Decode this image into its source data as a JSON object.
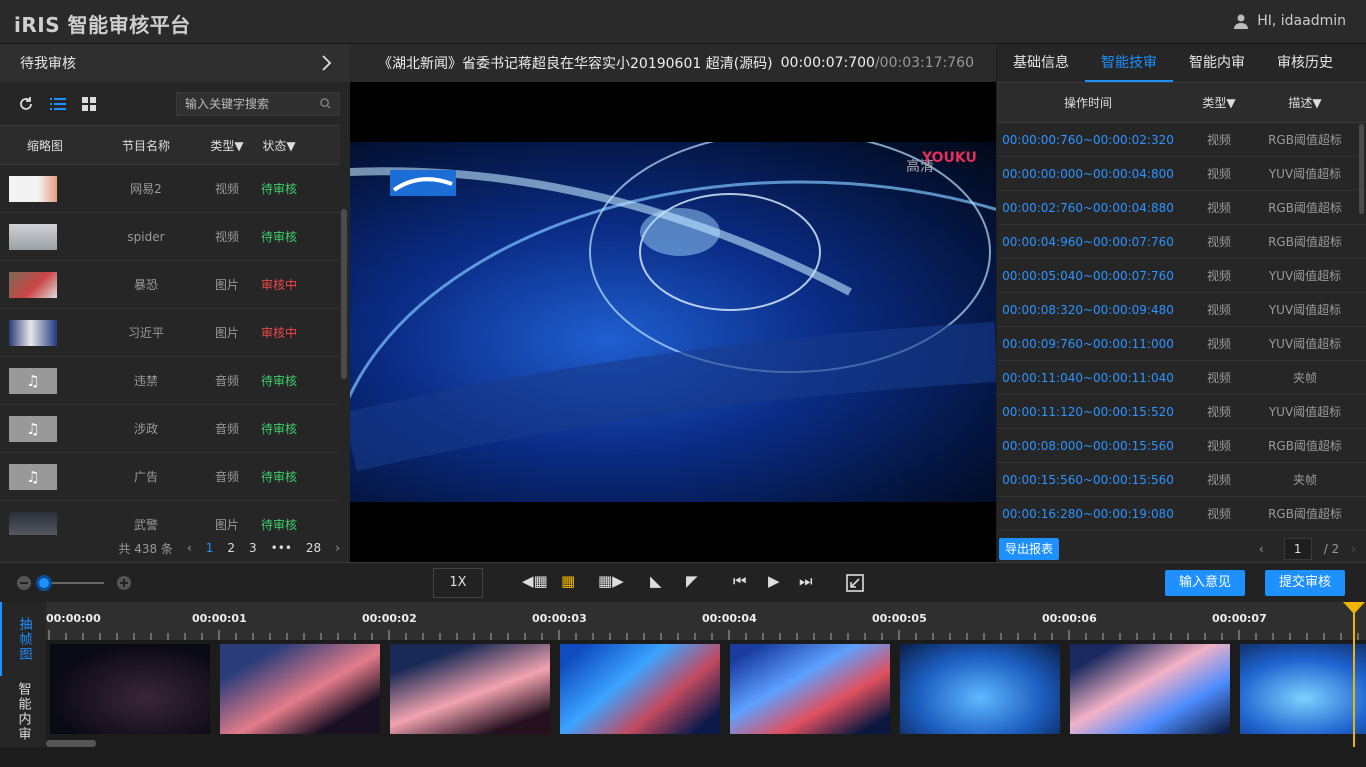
{
  "app": {
    "logo": "iRIS  智能审核平台",
    "user": "HI, idaadmin"
  },
  "left": {
    "title": "待我审核",
    "search_placeholder": "输入关键字搜索",
    "columns": [
      "缩略图",
      "节目名称",
      "类型",
      "状态"
    ],
    "rows": [
      {
        "name": "网易2",
        "type": "视频",
        "status": "待审核",
        "state": "ok"
      },
      {
        "name": "spider",
        "type": "视频",
        "status": "待审核",
        "state": "ok"
      },
      {
        "name": "暴恐",
        "type": "图片",
        "status": "审核中",
        "state": "ing"
      },
      {
        "name": "习近平",
        "type": "图片",
        "status": "审核中",
        "state": "ing"
      },
      {
        "name": "违禁",
        "type": "音频",
        "status": "待审核",
        "state": "ok"
      },
      {
        "name": "涉政",
        "type": "音频",
        "status": "待审核",
        "state": "ok"
      },
      {
        "name": "广告",
        "type": "音频",
        "status": "待审核",
        "state": "ok"
      },
      {
        "name": "武警",
        "type": "图片",
        "status": "待审核",
        "state": "ok"
      }
    ],
    "pager": {
      "total": "共 438 条",
      "pages": [
        "1",
        "2",
        "3",
        "•••",
        "28"
      ]
    }
  },
  "center": {
    "title": "《湖北新闻》省委书记蒋超良在华容实小20190601 超清(源码)",
    "current_time": "00:00:07:700",
    "duration": "/00:03:17:760",
    "watermark": "高清",
    "brand": "YOUKU"
  },
  "right": {
    "tabs": [
      "基础信息",
      "智能技审",
      "智能内审",
      "审核历史"
    ],
    "columns": [
      "操作时间",
      "类型",
      "描述"
    ],
    "rows": [
      {
        "time": "00:00:00:760~00:00:02:320",
        "type": "视频",
        "desc": "RGB阈值超标"
      },
      {
        "time": "00:00:00:000~00:00:04:800",
        "type": "视频",
        "desc": "YUV阈值超标"
      },
      {
        "time": "00:00:02:760~00:00:04:880",
        "type": "视频",
        "desc": "RGB阈值超标"
      },
      {
        "time": "00:00:04:960~00:00:07:760",
        "type": "视频",
        "desc": "RGB阈值超标"
      },
      {
        "time": "00:00:05:040~00:00:07:760",
        "type": "视频",
        "desc": "YUV阈值超标"
      },
      {
        "time": "00:00:08:320~00:00:09:480",
        "type": "视频",
        "desc": "YUV阈值超标"
      },
      {
        "time": "00:00:09:760~00:00:11:000",
        "type": "视频",
        "desc": "YUV阈值超标"
      },
      {
        "time": "00:00:11:040~00:00:11:040",
        "type": "视频",
        "desc": "夹帧"
      },
      {
        "time": "00:00:11:120~00:00:15:520",
        "type": "视频",
        "desc": "YUV阈值超标"
      },
      {
        "time": "00:00:08:000~00:00:15:560",
        "type": "视频",
        "desc": "RGB阈值超标"
      },
      {
        "time": "00:00:15:560~00:00:15:560",
        "type": "视频",
        "desc": "夹帧"
      },
      {
        "time": "00:00:16:280~00:00:19:080",
        "type": "视频",
        "desc": "RGB阈值超标"
      }
    ],
    "export_label": "导出报表",
    "page_current": "1",
    "page_total": "/ 2"
  },
  "controls": {
    "speed": "1X",
    "input_opinion": "输入意见",
    "submit": "提交审核"
  },
  "timeline": {
    "side_a": "抽帧图",
    "side_b": "智能内审",
    "ticks": [
      "00:00:00",
      "00:00:01",
      "00:00:02",
      "00:00:03",
      "00:00:04",
      "00:00:05",
      "00:00:06",
      "00:00:07"
    ]
  },
  "colors": {
    "accent": "#1e90ff",
    "ok": "#3fd06b",
    "ing": "#f0464a"
  }
}
